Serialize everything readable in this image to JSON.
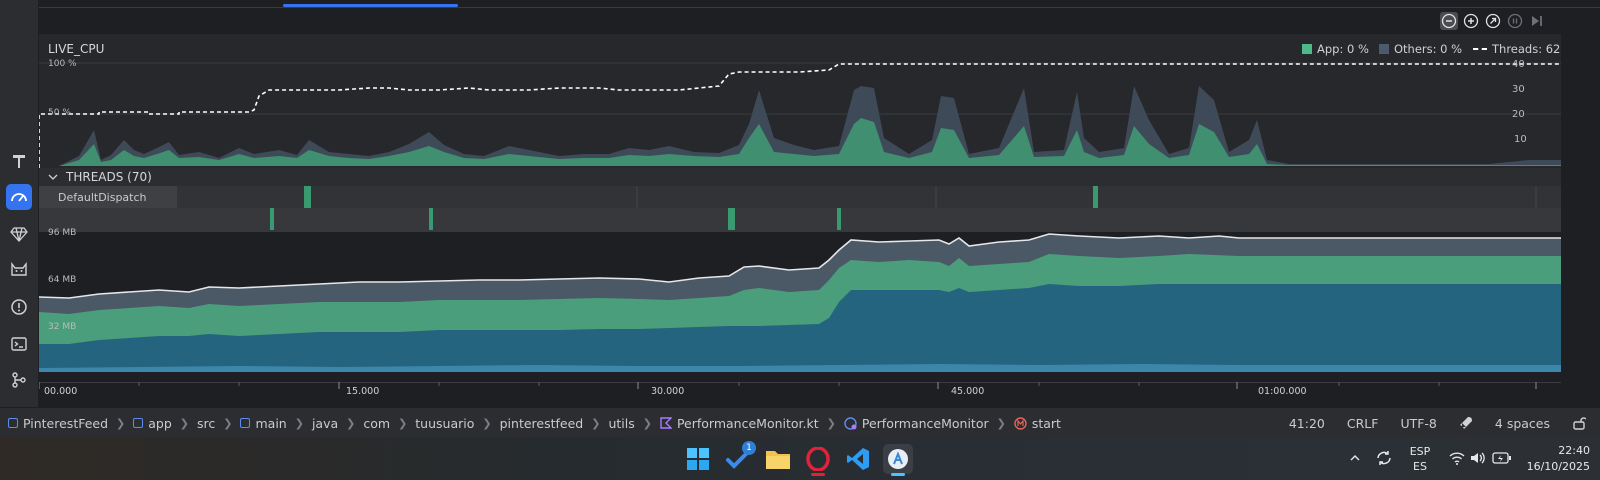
{
  "cpu": {
    "title": "LIVE_CPU",
    "axis_left": [
      "100 %",
      "50 %"
    ],
    "axis_right": [
      "40",
      "30",
      "20",
      "10"
    ],
    "legend": [
      {
        "label": "App: 0 %",
        "color": "#4fb98a"
      },
      {
        "label": "Others: 0 %",
        "color": "#4b5a6c"
      },
      {
        "label": "Threads: 62",
        "color": "#ffffff",
        "dashed": true
      }
    ]
  },
  "threads": {
    "label": "THREADS (70)",
    "row_name": "DefaultDispatch"
  },
  "memory": {
    "axis": [
      "96 MB",
      "64 MB",
      "32 MB"
    ]
  },
  "time_axis": {
    "labels": [
      "00.000",
      "15.000",
      "30.000",
      "45.000",
      "01:00.000"
    ]
  },
  "breadcrumb": {
    "items": [
      {
        "label": "PinterestFeed",
        "icon": "module-icon"
      },
      {
        "label": "app",
        "icon": "module-icon"
      },
      {
        "label": "src",
        "icon": ""
      },
      {
        "label": "main",
        "icon": "module-icon"
      },
      {
        "label": "java",
        "icon": ""
      },
      {
        "label": "com",
        "icon": ""
      },
      {
        "label": "tuusuario",
        "icon": ""
      },
      {
        "label": "pinterestfeed",
        "icon": ""
      },
      {
        "label": "utils",
        "icon": ""
      },
      {
        "label": "PerformanceMonitor.kt",
        "icon": "kotlin-file-icon"
      },
      {
        "label": "PerformanceMonitor",
        "icon": "class-icon"
      },
      {
        "label": "start",
        "icon": "method-icon"
      }
    ]
  },
  "status": {
    "position": "41:20",
    "line_ending": "CRLF",
    "encoding": "UTF-8",
    "indent": "4 spaces"
  },
  "taskbar": {
    "badge": "1",
    "lang_top": "ESP",
    "lang_bottom": "ES",
    "time": "22:40",
    "date": "16/10/2025"
  }
}
